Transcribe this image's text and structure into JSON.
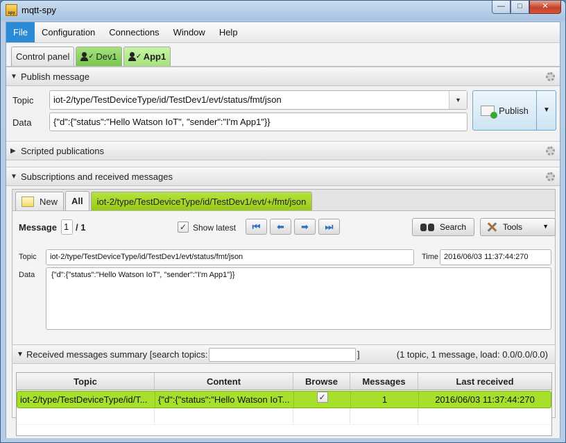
{
  "window": {
    "title": "mqtt-spy",
    "icon_text": "spy"
  },
  "menu": [
    "File",
    "Configuration",
    "Connections",
    "Window",
    "Help"
  ],
  "connection_tabs": [
    {
      "label": "Control panel"
    },
    {
      "label": "Dev1"
    },
    {
      "label": "App1"
    }
  ],
  "publish": {
    "header": "Publish message",
    "topic_label": "Topic",
    "topic_value": "iot-2/type/TestDeviceType/id/TestDev1/evt/status/fmt/json",
    "data_label": "Data",
    "data_value": "{\"d\":{\"status\":\"Hello Watson IoT\", \"sender\":\"I'm App1\"}}",
    "publish_label": "Publish"
  },
  "scripted": {
    "header": "Scripted publications"
  },
  "subscriptions": {
    "header": "Subscriptions and received messages",
    "tabs": {
      "new_label": "New",
      "all_label": "All",
      "topic_label": "iot-2/type/TestDeviceType/id/TestDev1/evt/+/fmt/json"
    },
    "message_label": "Message",
    "message_index": "1",
    "message_total": "/ 1",
    "show_latest_label": "Show latest",
    "show_latest_checked": "✓",
    "search_label": "Search",
    "tools_label": "Tools",
    "topic_label": "Topic",
    "topic_value": "iot-2/type/TestDeviceType/id/TestDev1/evt/status/fmt/json",
    "time_label": "Time",
    "time_value": "2016/06/03 11:37:44:270",
    "data_label": "Data",
    "data_value": "{\"d\":{\"status\":\"Hello Watson IoT\", \"sender\":\"I'm App1\"}}"
  },
  "summary": {
    "header": "Received messages summary [search topics:",
    "bracket": "]",
    "stats": "(1 topic, 1 message, load: 0.0/0.0/0.0)",
    "columns": [
      "Topic",
      "Content",
      "Browse",
      "Messages",
      "Last received"
    ],
    "rows": [
      {
        "topic": "iot-2/type/TestDeviceType/id/T...",
        "content": "{\"d\":{\"status\":\"Hello Watson IoT...",
        "browse": "✓",
        "messages": "1",
        "last_received": "2016/06/03 11:37:44:270"
      }
    ]
  },
  "colors": {
    "accent": "#2b8bd6",
    "connection_green": "#a6e27e",
    "row_highlight": "#a7e02c"
  }
}
